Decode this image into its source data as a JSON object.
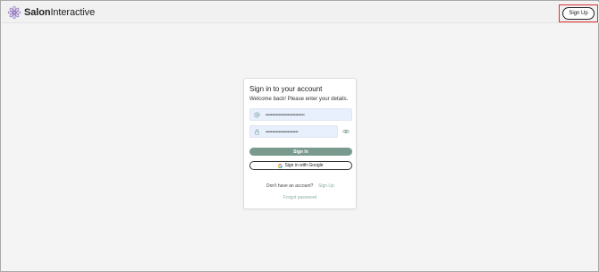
{
  "app": {
    "logo_bold": "Salon",
    "logo_rest": "Interactive",
    "accent_color": "#7a9a8e",
    "link_color": "#8aaea2",
    "highlight_color": "#e03030"
  },
  "header": {
    "signup_label": "Sign Up"
  },
  "card": {
    "title": "Sign in to your account",
    "subtitle": "Welcome back! Please enter your details.",
    "email": {
      "value": "••••••••••••••••••••••••••••••",
      "icon": "at-sign-icon"
    },
    "password": {
      "value": "•••••••••••••••••••••••••",
      "icon": "lock-icon",
      "toggle_icon": "eye-icon"
    },
    "signin_label": "Sign In",
    "google_label": "Sign in with Google",
    "no_account_text": "Don't have an account?",
    "signup_link": "Sign Up",
    "forgot_link": "Forgot password"
  }
}
